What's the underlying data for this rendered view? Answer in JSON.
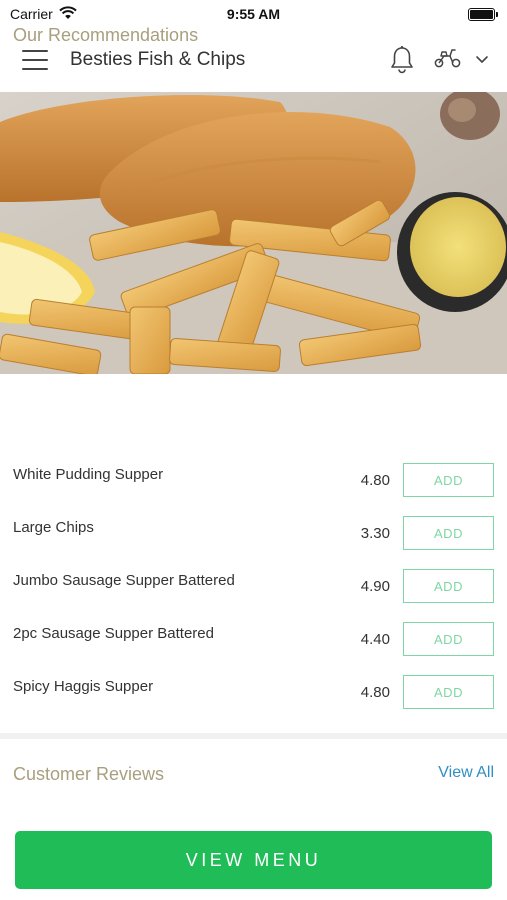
{
  "status_bar": {
    "carrier": "Carrier",
    "time": "9:55 AM"
  },
  "header": {
    "title": "Besties Fish & Chips",
    "icons": [
      "menu-icon",
      "bell-icon",
      "scooter-icon",
      "chevron-down-icon"
    ]
  },
  "hero": {
    "icon": "fish-and-chips-photo"
  },
  "recommendations": {
    "title": "Our Recommendations",
    "items": [
      {
        "name": "White Pudding Supper",
        "price": "4.80",
        "button": "ADD"
      },
      {
        "name": "Large Chips",
        "price": "3.30",
        "button": "ADD"
      },
      {
        "name": "Jumbo Sausage Supper Battered",
        "price": "4.90",
        "button": "ADD"
      },
      {
        "name": "2pc Sausage Supper Battered",
        "price": "4.40",
        "button": "ADD"
      },
      {
        "name": "Spicy Haggis Supper",
        "price": "4.80",
        "button": "ADD"
      }
    ]
  },
  "reviews": {
    "title": "Customer Reviews",
    "view_all": "View All"
  },
  "cta": {
    "label": "VIEW MENU"
  },
  "colors": {
    "accent_green": "#20bc58",
    "add_button_border": "#7fd6a4",
    "section_title": "#a89f7e",
    "link_blue": "#2f8fc3"
  }
}
